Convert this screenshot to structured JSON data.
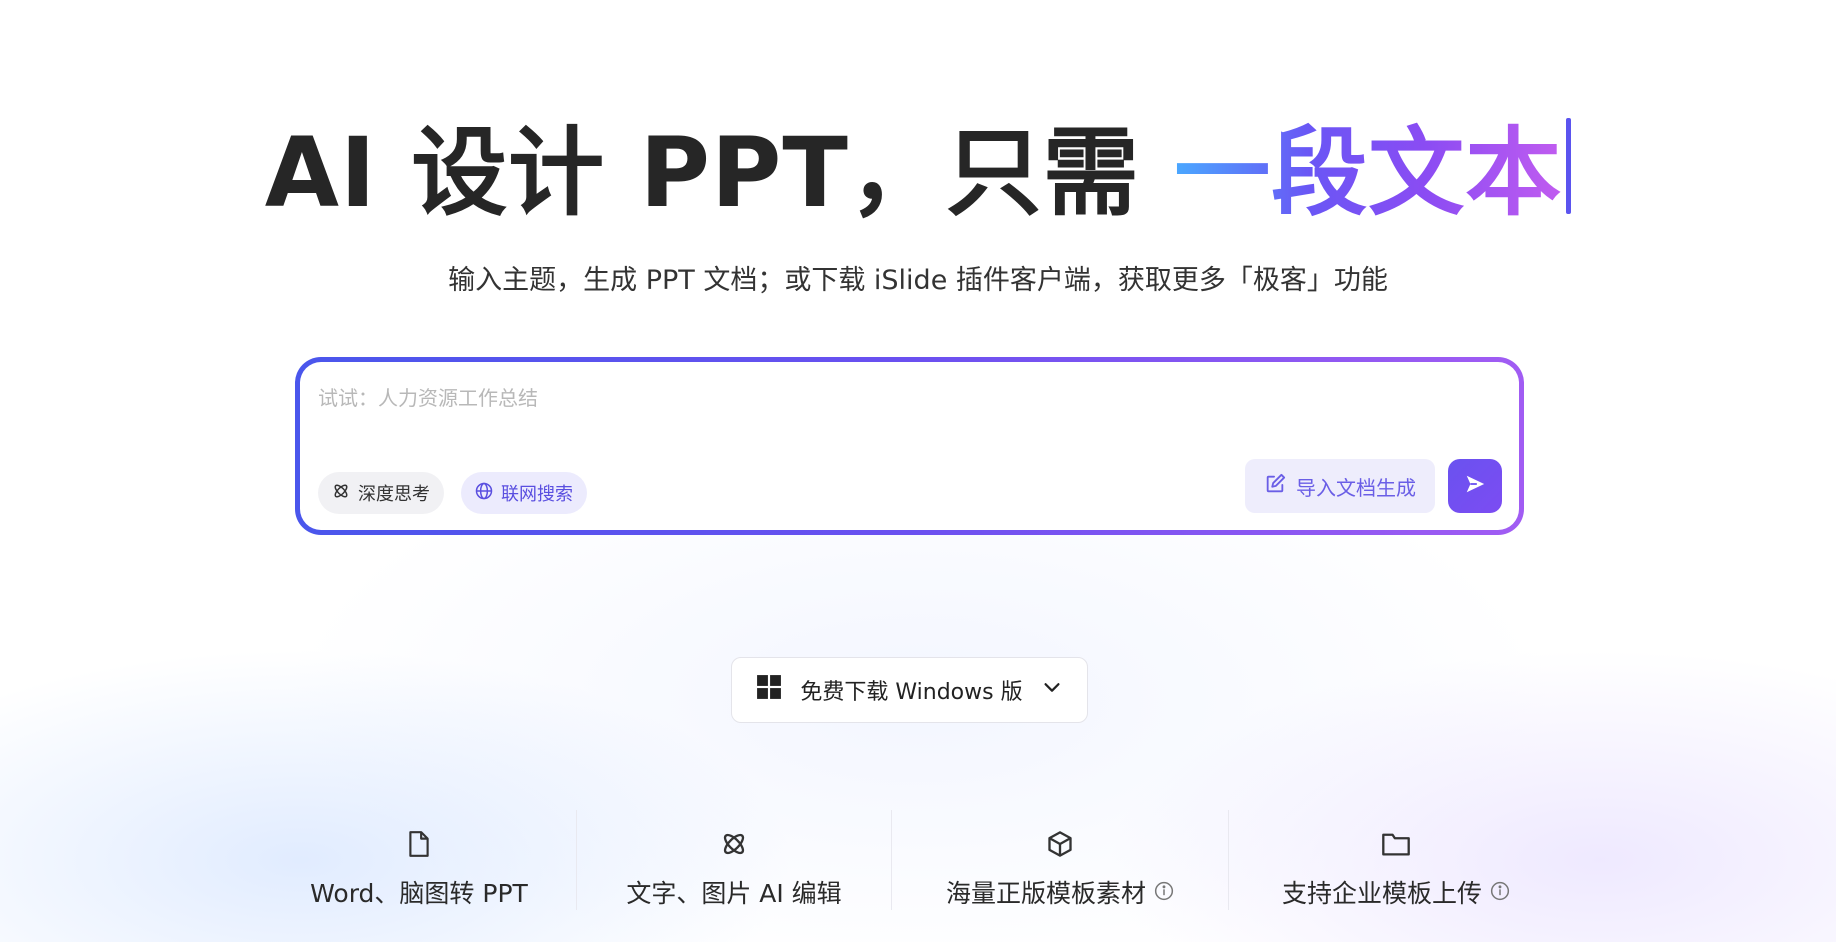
{
  "hero": {
    "title_plain": "AI 设计 PPT，只需 ",
    "title_highlight": "一段文本"
  },
  "subtitle": "输入主题，生成 PPT 文档；或下载 iSlide 插件客户端，获取更多「极客」功能",
  "prompt": {
    "placeholder": "试试：人力资源工作总结",
    "value": "",
    "deep_think_label": "深度思考",
    "deep_think_icon": "atom-icon",
    "web_search_label": "联网搜索",
    "web_search_icon": "globe-icon",
    "import_label": "导入文档生成",
    "import_icon": "edit-square-icon",
    "send_icon": "send-icon"
  },
  "download": {
    "label": "免费下载 Windows 版",
    "icon": "windows-icon",
    "chevron": "chevron-down-icon"
  },
  "features": [
    {
      "label": "Word、脑图转 PPT",
      "icon": "file-icon",
      "info": false
    },
    {
      "label": "文字、图片 AI 编辑",
      "icon": "atom-icon",
      "info": false
    },
    {
      "label": "海量正版模板素材",
      "icon": "cube-icon",
      "info": true
    },
    {
      "label": "支持企业模板上传",
      "icon": "folder-icon",
      "info": true
    }
  ],
  "colors": {
    "accent": "#5b54ef",
    "accent_light": "#eeedfc",
    "gradient_start": "#4aa8ff",
    "gradient_end": "#c15cf0"
  }
}
